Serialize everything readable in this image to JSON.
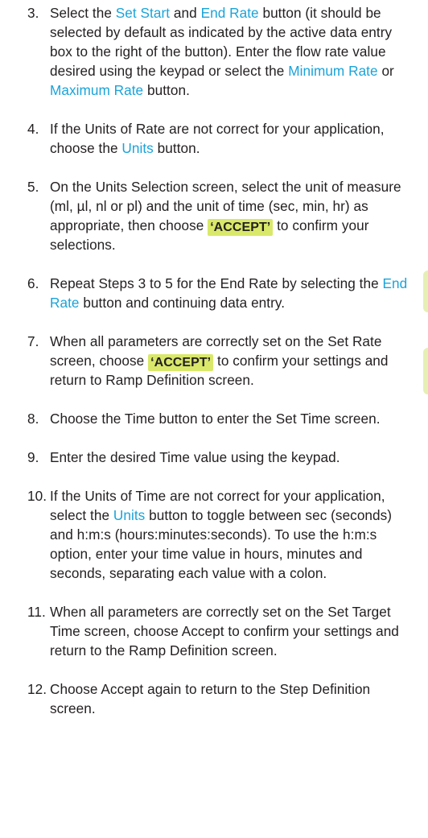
{
  "steps": [
    {
      "number": "3.",
      "t1": "Select the ",
      "l1": "Set Start",
      "t2": " and ",
      "l2": "End Rate",
      "t3": " button (it should be selected by default as indicated by the active data entry box to the right of the button). Enter the flow rate value desired using the keypad or select the ",
      "l3": "Minimum Rate",
      "t4": " or ",
      "l4": "Maximum Rate",
      "t5": " button."
    },
    {
      "number": "4.",
      "t1": "If the Units of Rate are not correct for your application, choose the ",
      "l1": "Units",
      "t2": " button."
    },
    {
      "number": "5.",
      "t1": "On the Units Selection screen, select the unit of measure (ml, µl, nl or pl) and the unit of time (sec, min, hr) as appropriate, then choose ",
      "badge": "‘ACCEPT’",
      "t2": " to confirm your selections."
    },
    {
      "number": "6.",
      "t1": "Repeat Steps 3 to 5 for the End Rate by selecting the ",
      "l1": "End Rate",
      "t2": " button and continuing data entry."
    },
    {
      "number": "7.",
      "t1": "When all parameters are correctly set on the Set Rate screen, choose ",
      "badge": "‘ACCEPT’",
      "t2": " to confirm your settings and return to Ramp Definition screen."
    },
    {
      "number": "8.",
      "t1": "Choose the Time button to enter the Set Time screen."
    },
    {
      "number": "9.",
      "t1": "Enter the desired Time value using the keypad."
    },
    {
      "number": "10.",
      "t1": "If the Units of Time are not correct for your application, select the ",
      "l1": "Units",
      "t2": " button to toggle between sec (seconds) and h:m:s (hours:minutes:seconds). To use the h:m:s option, enter your time value in hours, minutes and seconds, separating each value with a colon."
    },
    {
      "number": "11.",
      "t1": "When all parameters are correctly set on the Set Target Time screen, choose Accept to confirm your settings and return to the Ramp Definition screen."
    },
    {
      "number": "12.",
      "t1": "Choose Accept again to return to the Step Definition screen."
    }
  ],
  "colors": {
    "link": "#1aa3d9",
    "badge_bg": "#d9e86a",
    "text": "#231f20",
    "edge_tab": "#e6efb4"
  }
}
